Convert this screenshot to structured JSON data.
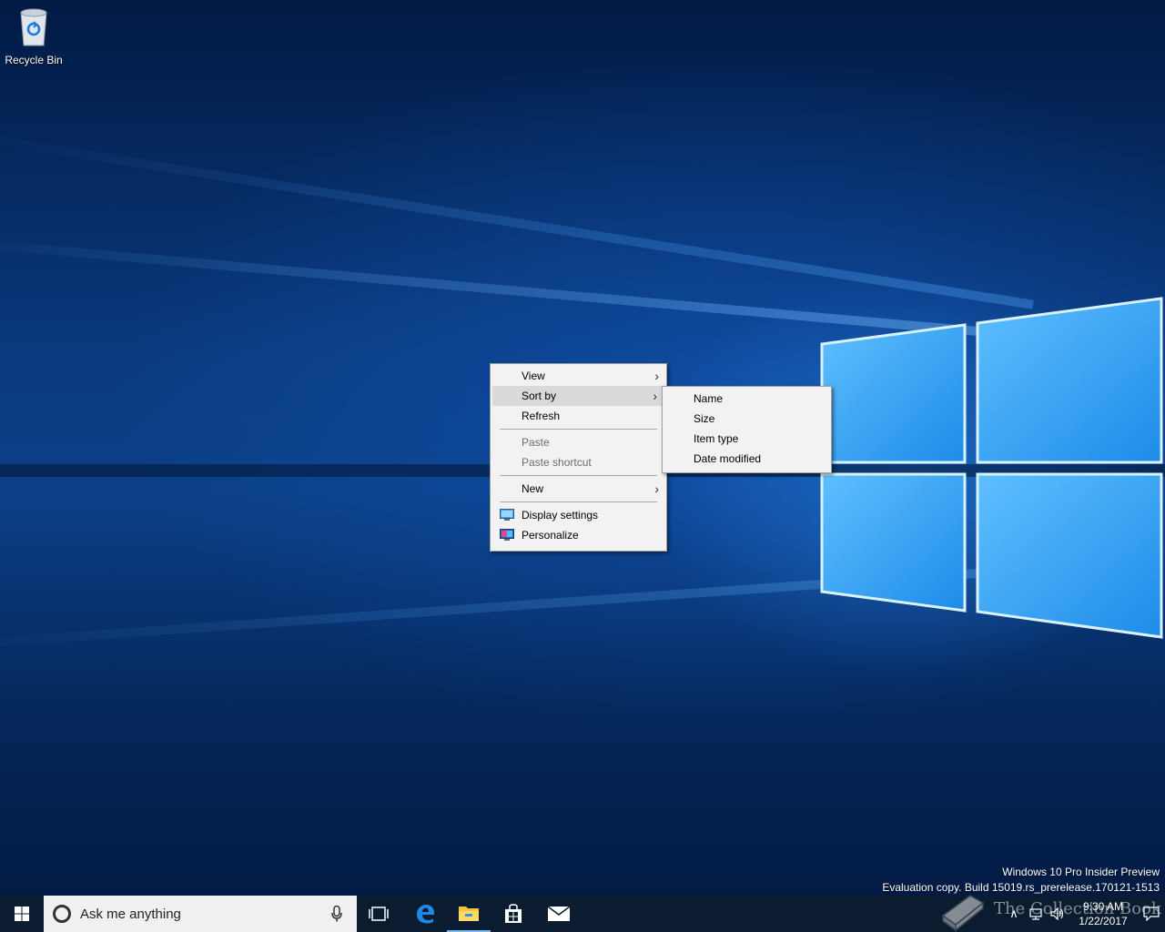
{
  "desktop": {
    "icons": [
      {
        "label": "Recycle Bin",
        "icon": "recycle-bin-icon"
      }
    ]
  },
  "context_menu": {
    "items": [
      {
        "label": "View",
        "submenu": true,
        "enabled": true
      },
      {
        "label": "Sort by",
        "submenu": true,
        "enabled": true,
        "selected": true
      },
      {
        "label": "Refresh",
        "enabled": true
      },
      {
        "label": "Paste",
        "enabled": false
      },
      {
        "label": "Paste shortcut",
        "enabled": false
      },
      {
        "label": "New",
        "submenu": true,
        "enabled": true
      },
      {
        "label": "Display settings",
        "icon": "display-settings-icon",
        "enabled": true
      },
      {
        "label": "Personalize",
        "icon": "personalize-icon",
        "enabled": true
      }
    ]
  },
  "sort_submenu": {
    "items": [
      {
        "label": "Name"
      },
      {
        "label": "Size"
      },
      {
        "label": "Item type"
      },
      {
        "label": "Date modified"
      }
    ]
  },
  "watermark": {
    "line1": "Windows 10 Pro Insider Preview",
    "line2": "Evaluation copy. Build 15019.rs_prerelease.170121-1513"
  },
  "taskbar": {
    "search_placeholder": "Ask me anything",
    "pinned": [
      "task-view-icon",
      "edge-icon",
      "file-explorer-icon",
      "store-icon",
      "mail-icon"
    ],
    "clock": {
      "time": "9:30 AM",
      "date": "1/22/2017"
    }
  },
  "overlay": {
    "text": "The Collection Book"
  },
  "colors": {
    "taskbar": "#0b1c30",
    "menu_background": "#f2f2f2",
    "menu_selected": "#d9d9d9",
    "desktop_blue": "#0b3f86"
  }
}
